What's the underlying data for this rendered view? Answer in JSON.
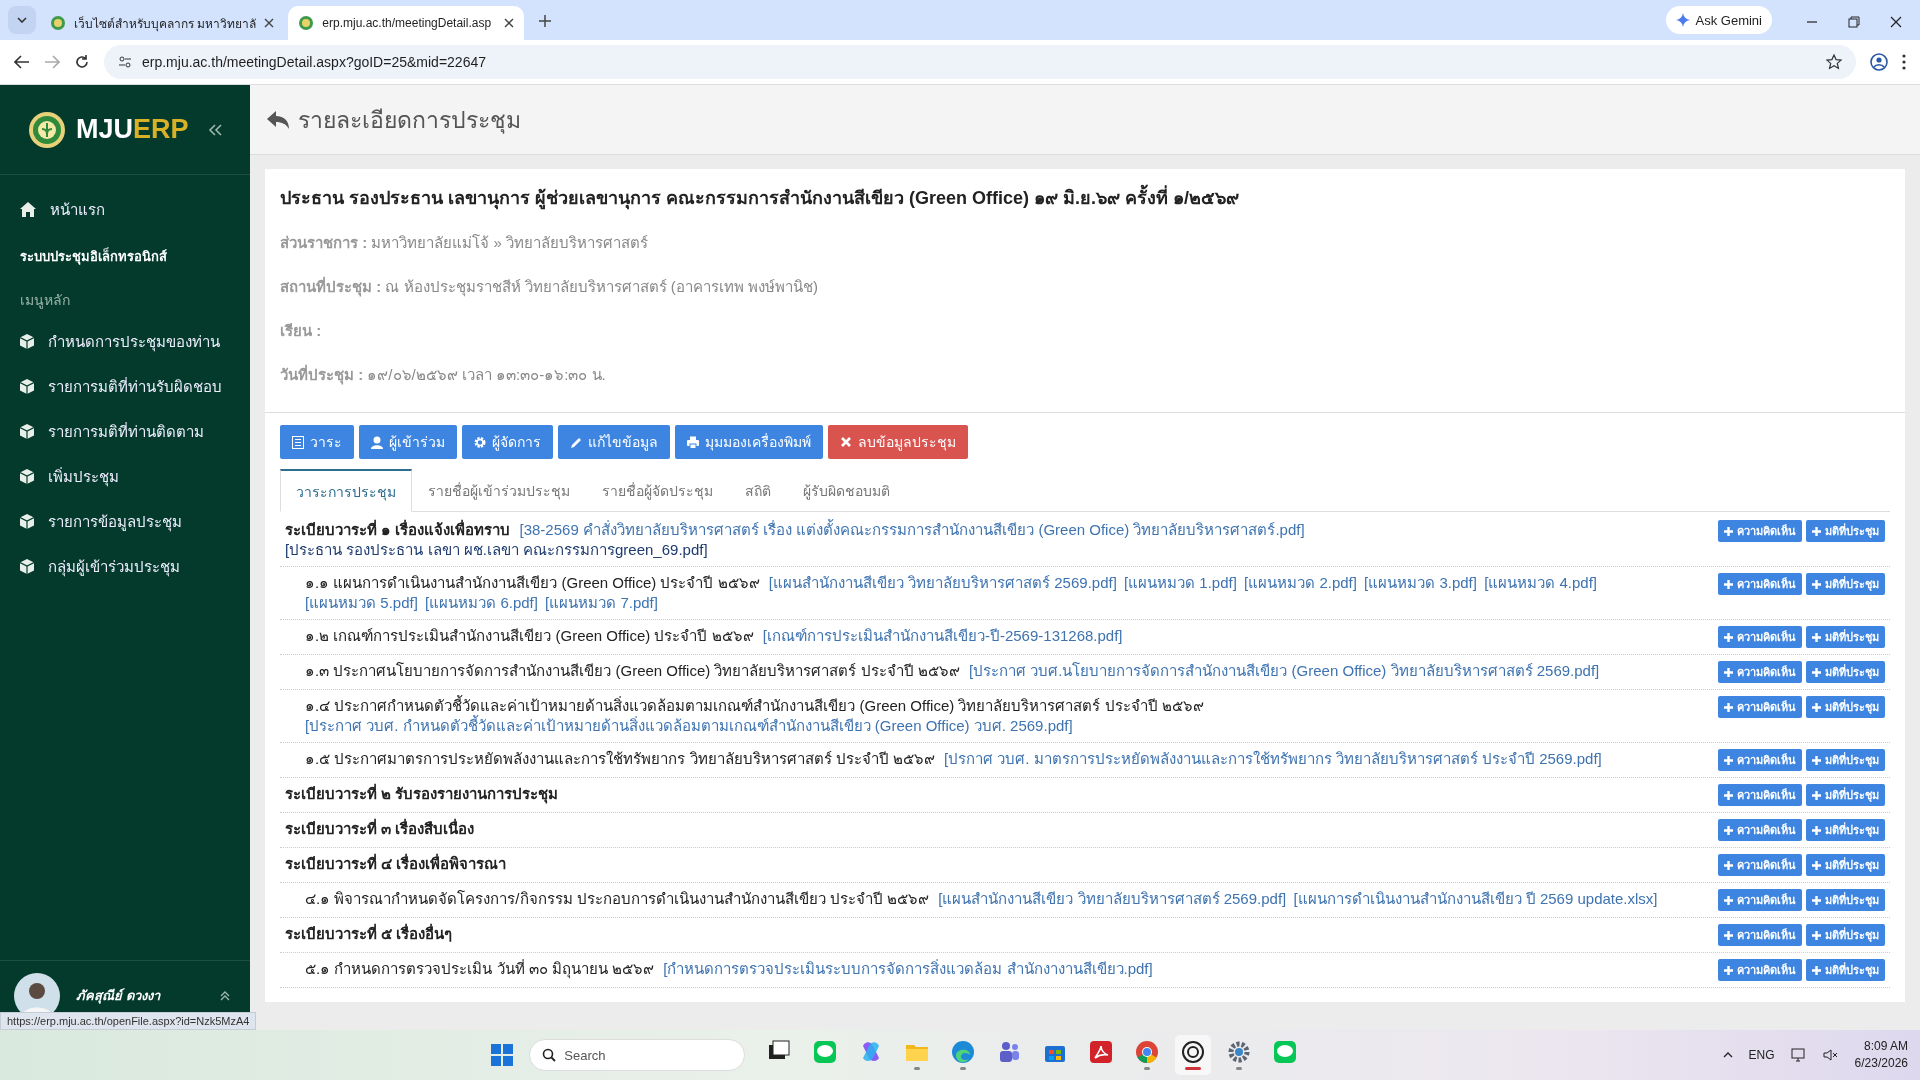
{
  "browser": {
    "tabs": [
      {
        "title": "เว็บไซต์สำหรับบุคลากร มหาวิทยาลั",
        "selected": false
      },
      {
        "title": "erp.mju.ac.th/meetingDetail.asp",
        "selected": true
      }
    ],
    "gemini": "Ask Gemini",
    "url": "erp.mju.ac.th/meetingDetail.aspx?goID=25&mid=22647"
  },
  "sidebar": {
    "logo": {
      "part_1": "MJU",
      "part_2": "ERP"
    },
    "home": "หน้าแรก",
    "section": "ระบบประชุมอิเล็กทรอนิกส์",
    "menu_heading": "เมนูหลัก",
    "items": [
      "กำหนดการประชุมของท่าน",
      "รายการมติที่ท่านรับผิดชอบ",
      "รายการมติที่ท่านติดตาม",
      "เพิ่มประชุม",
      "รายการข้อมูลประชุม",
      "กลุ่มผู้เข้าร่วมประชุม"
    ],
    "user": "ภัคสุณีย์ ดวงงา"
  },
  "page_title": "รายละเอียดการประชุม",
  "meeting": {
    "title": "ประธาน รองประธาน เลขานุการ ผู้ช่วยเลขานุการ คณะกรรมการสำนักงานสีเขียว (Green Office) ๑๙ มิ.ย.๖๙  ครั้งที่ ๑/๒๕๖๙",
    "fields": [
      {
        "label": "ส่วนราชการ :",
        "value": "มหาวิทยาลัยแม่โจ้ » วิทยาลัยบริหารศาสตร์"
      },
      {
        "label": "สถานที่ประชุม :",
        "value": "ณ ห้องประชุมราชสีห์ วิทยาลัยบริหารศาสตร์ (อาคารเทพ พงษ์พานิช)"
      },
      {
        "label": "เรียน :"
      },
      {
        "label": "วันที่ประชุม :",
        "value": "๑๙/๐๖/๒๕๖๙ เวลา ๑๓:๓๐-๑๖:๓๐ น."
      }
    ]
  },
  "actions": [
    {
      "label": "วาระ",
      "kind": "primary"
    },
    {
      "label": "ผู้เข้าร่วม",
      "kind": "primary"
    },
    {
      "label": "ผู้จัดการ",
      "kind": "primary"
    },
    {
      "label": "แก้ไขข้อมูล",
      "kind": "primary"
    },
    {
      "label": "มุมมองเครื่องพิมพ์",
      "kind": "primary"
    },
    {
      "label": "ลบข้อมูลประชุม",
      "kind": "danger"
    }
  ],
  "tabs": [
    {
      "label": "วาระการประชุม",
      "selected": true
    },
    {
      "label": "รายชื่อผู้เข้าร่วมประชุม",
      "selected": false
    },
    {
      "label": "รายชื่อผู้จัดประชุม",
      "selected": false
    },
    {
      "label": "สถิติ",
      "selected": false
    },
    {
      "label": "ผู้รับผิดชอบมติ",
      "selected": false
    }
  ],
  "agenda": [
    {
      "kind": "heading",
      "text": "ระเบียบวาระที่ ๑ เรื่องแจ้งเพื่อทราบ",
      "links": [
        {
          "text": "[38-2569 คำสั่งวิทยาลัยบริหารศาสตร์ เรื่อง แต่งตั้งคณะกรรมการสำนักงานสีเขียว (Green Ofice) วิทยาลัยบริหารศาสตร์.pdf]",
          "visited": false
        },
        {
          "text": "[ประธาน รองประธาน เลขา ผช.เลขา คณะกรรมการgreen_69.pdf]",
          "visited": true
        }
      ],
      "buttons": [
        "ความคิดเห็น",
        "มติที่ประชุม"
      ]
    },
    {
      "kind": "sub",
      "text": "๑.๑ แผนการดำเนินงานสำนักงานสีเขียว (Green Office) ประจำปี ๒๕๖๙",
      "links": [
        {
          "text": "[แผนสำนักงานสีเขียว วิทยาลัยบริหารศาสตร์ 2569.pdf]",
          "visited": false
        },
        {
          "text": "[แผนหมวด 1.pdf]",
          "visited": false
        },
        {
          "text": "[แผนหมวด 2.pdf]",
          "visited": false
        },
        {
          "text": "[แผนหมวด 3.pdf]",
          "visited": false
        },
        {
          "text": "[แผนหมวด 4.pdf]",
          "visited": false
        },
        {
          "text": "[แผนหมวด 5.pdf]",
          "visited": false
        },
        {
          "text": "[แผนหมวด 6.pdf]",
          "visited": false
        },
        {
          "text": "[แผนหมวด 7.pdf]",
          "visited": false
        }
      ],
      "buttons": [
        "ความคิดเห็น",
        "มติที่ประชุม"
      ]
    },
    {
      "kind": "sub",
      "text": "๑.๒ เกณฑ์การประเมินสำนักงานสีเขียว (Green Office) ประจำปี ๒๕๖๙",
      "links": [
        {
          "text": "[เกณฑ์การประเมินสำนักงานสีเขียว-ปี-2569-131268.pdf]",
          "visited": false
        }
      ],
      "buttons": [
        "ความคิดเห็น",
        "มติที่ประชุม"
      ]
    },
    {
      "kind": "sub",
      "text": "๑.๓ ประกาศนโยบายการจัดการสำนักงานสีเขียว (Green Office) วิทยาลัยบริหารศาสตร์ ประจำปี ๒๕๖๙",
      "links": [
        {
          "text": "[ประกาศ วบศ.นโยบายการจัดการสำนักงานสีเขียว (Green Office) วิทยาลัยบริหารศาสตร์ 2569.pdf]",
          "visited": false
        }
      ],
      "buttons": [
        "ความคิดเห็น",
        "มติที่ประชุม"
      ]
    },
    {
      "kind": "sub",
      "text": "๑.๔ ประกาศกำหนดตัวชี้วัดและค่าเป้าหมายด้านสิ่งแวดล้อมตามเกณฑ์สำนักงานสีเขียว (Green Office) วิทยาลัยบริหารศาสตร์ ประจำปี ๒๕๖๙",
      "links": [
        {
          "text": "[ประกาศ วบศ. กำหนดตัวชี้วัดและค่าเป้าหมายด้านสิ่งแวดล้อมตามเกณฑ์สำนักงานสีเขียว (Green Office) วบศ. 2569.pdf]",
          "visited": false
        }
      ],
      "buttons": [
        "ความคิดเห็น",
        "มติที่ประชุม"
      ]
    },
    {
      "kind": "sub",
      "text": "๑.๕ ประกาศมาตรการประหยัดพลังงานและการใช้ทรัพยากร วิทยาลัยบริหารศาสตร์ ประจำปี ๒๕๖๙",
      "links": [
        {
          "text": "[ปรกาศ วบศ. มาตรการประหยัดพลังงานและการใช้ทรัพยากร วิทยาลัยบริหารศาสตร์ ประจำปี 2569.pdf]",
          "visited": false
        }
      ],
      "buttons": [
        "ความคิดเห็น",
        "มติที่ประชุม"
      ]
    },
    {
      "kind": "heading",
      "text": "ระเบียบวาระที่ ๒ รับรองรายงานการประชุม",
      "buttons": [
        "ความคิดเห็น",
        "มติที่ประชุม"
      ]
    },
    {
      "kind": "heading",
      "text": "ระเบียบวาระที่ ๓ เรื่องสืบเนื่อง",
      "buttons": [
        "ความคิดเห็น",
        "มติที่ประชุม"
      ]
    },
    {
      "kind": "heading",
      "text": "ระเบียบวาระที่ ๔ เรื่องเพื่อพิจารณา",
      "buttons": [
        "ความคิดเห็น",
        "มติที่ประชุม"
      ]
    },
    {
      "kind": "sub",
      "text": "๔.๑ พิจารณากำหนดจัดโครงการ/กิจกรรม ประกอบการดำเนินงานสำนักงานสีเขียว ประจำปี ๒๕๖๙",
      "links": [
        {
          "text": "[แผนสำนักงานสีเขียว วิทยาลัยบริหารศาสตร์ 2569.pdf]",
          "visited": false
        },
        {
          "text": "[แผนการดำเนินงานสำนักงานสีเขียว ปี 2569 update.xlsx]",
          "visited": false
        }
      ],
      "buttons": [
        "ความคิดเห็น",
        "มติที่ประชุม"
      ]
    },
    {
      "kind": "heading",
      "text": "ระเบียบวาระที่ ๕ เรื่องอื่นๆ",
      "buttons": [
        "ความคิดเห็น",
        "มติที่ประชุม"
      ]
    },
    {
      "kind": "sub",
      "text": "๕.๑ กำหนดการตรวจประเมิน วันที่ ๓๐ มิถุนายน ๒๕๖๙",
      "links": [
        {
          "text": "[กำหนดการตรวจประเมินระบบการจัดการสิ่งแวดล้อม สำนักงางานสีเขียว.pdf]",
          "visited": false
        }
      ],
      "buttons": [
        "ความคิดเห็น",
        "มติที่ประชุม"
      ]
    }
  ],
  "status_url": "https://erp.mju.ac.th/openFile.aspx?id=Nzk5MzA4",
  "taskbar": {
    "search_placeholder": "Search",
    "apps": [
      {
        "kind": "taskview",
        "running": false,
        "selected": false
      },
      {
        "kind": "line",
        "running": false,
        "selected": false
      },
      {
        "kind": "copilot",
        "running": false,
        "selected": false
      },
      {
        "kind": "files",
        "running": true,
        "selected": false
      },
      {
        "kind": "edge",
        "running": true,
        "selected": false
      },
      {
        "kind": "teams",
        "running": false,
        "selected": false
      },
      {
        "kind": "store",
        "running": false,
        "selected": false
      },
      {
        "kind": "acrobat",
        "running": false,
        "selected": false
      },
      {
        "kind": "chrome",
        "running": true,
        "selected": false
      },
      {
        "kind": "chatgpt",
        "running": true,
        "selected": true
      },
      {
        "kind": "settings",
        "running": true,
        "selected": false
      },
      {
        "kind": "line",
        "running": false,
        "selected": false
      }
    ],
    "language": "ENG",
    "time": "8:09 AM",
    "date": "6/23/2026"
  }
}
